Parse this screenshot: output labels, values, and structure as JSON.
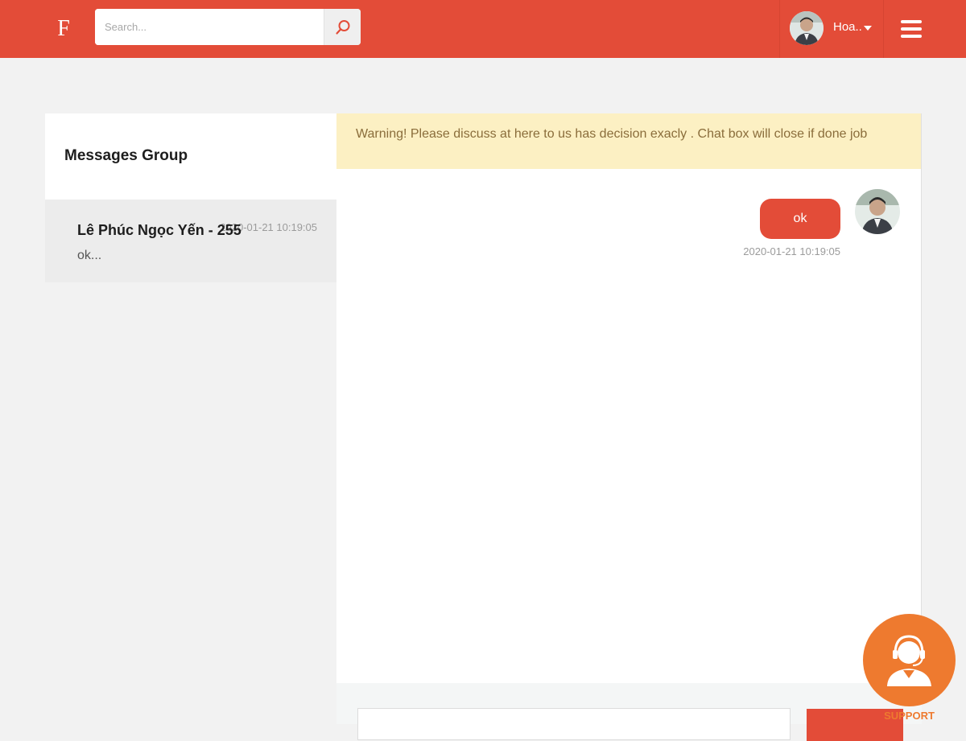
{
  "header": {
    "logo_letter": "F",
    "search_placeholder": "Search...",
    "user_name": "Hoa..",
    "brand_color": "#e34c38"
  },
  "sidebar": {
    "title": "Messages Group",
    "conversations": [
      {
        "name": "Lê Phúc Ngọc Yến - 255",
        "time": "2020-01-21 10:19:05",
        "preview": "ok..."
      }
    ]
  },
  "chat": {
    "warning": "Warning! Please discuss at here to us has decision exacly . Chat box will close if done job",
    "messages": [
      {
        "text": "ok",
        "time": "2020-01-21 10:19:05"
      }
    ]
  },
  "support": {
    "label": "SUPPORT",
    "color": "#ee7a2f"
  }
}
